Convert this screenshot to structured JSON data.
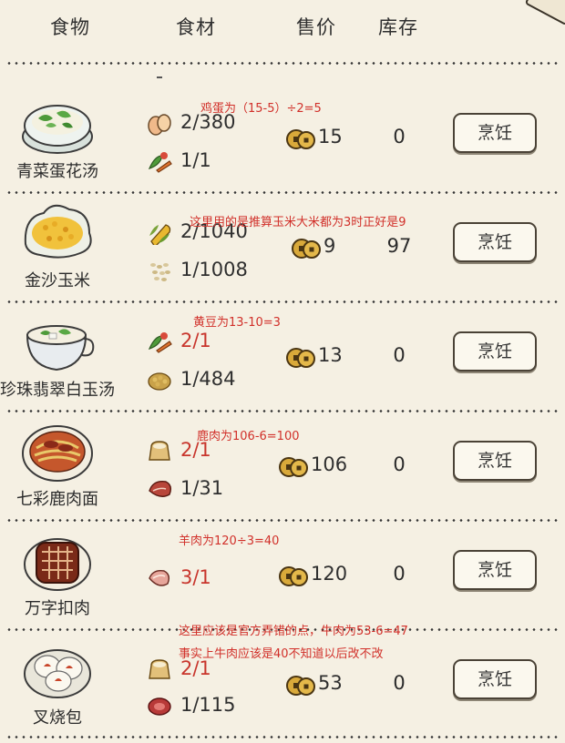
{
  "header": {
    "food": "食物",
    "ingredients": "食材",
    "price": "售价",
    "stock": "库存"
  },
  "cook_label": "烹饪",
  "rows": [
    {
      "name": "青菜蛋花汤",
      "ing1": "2/380",
      "ing2": "1/1",
      "price": "15",
      "stock": "0",
      "ing1_icon": "egg-icon",
      "ing2_icon": "vegetable-icon"
    },
    {
      "name": "金沙玉米",
      "ing1": "2/1040",
      "ing2": "1/1008",
      "price": "9",
      "stock": "97",
      "ing1_icon": "corn-icon",
      "ing2_icon": "rice-icon"
    },
    {
      "name": "珍珠翡翠白玉汤",
      "ing1": "2/1",
      "ing2": "1/484",
      "price": "13",
      "stock": "0",
      "ing1_icon": "vegetable-icon",
      "ing2_icon": "soybean-icon"
    },
    {
      "name": "七彩鹿肉面",
      "ing1": "2/1",
      "ing2": "1/31",
      "price": "106",
      "stock": "0",
      "ing1_icon": "flour-sack-icon",
      "ing2_icon": "venison-icon"
    },
    {
      "name": "万字扣肉",
      "ing1": "3/1",
      "price": "120",
      "stock": "0",
      "ing1_icon": "mutton-icon"
    },
    {
      "name": "叉烧包",
      "ing1": "2/1",
      "ing2": "1/115",
      "price": "53",
      "stock": "0",
      "ing1_icon": "flour-sack-icon",
      "ing2_icon": "beef-icon"
    }
  ],
  "notes": {
    "n1": "鸡蛋为（15-5）÷2=5",
    "n2": "这里用的是推算玉米大米都为3时正好是9",
    "n3": "黄豆为13-10=3",
    "n4": "鹿肉为106-6=100",
    "n5": "羊肉为120÷3=40",
    "n6": "这里应该是官方弄错的点，牛肉为53-6=47",
    "n7": "事实上牛肉应该是40不知道以后改不改"
  },
  "colors": {
    "background": "#f5f0e3",
    "shortage_text": "#c8352c",
    "annotation": "#d1302a"
  }
}
